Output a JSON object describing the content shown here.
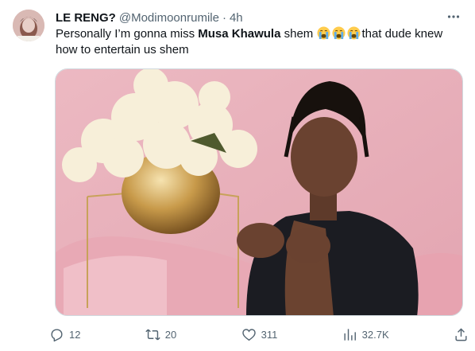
{
  "tweet": {
    "display_name": "LE RENG?",
    "handle": "@Modimoonrumile",
    "separator": "·",
    "time": "4h",
    "text_part1": "Personally I’m gonna miss ",
    "text_bold": "Musa Khawula",
    "text_part2": " shem ",
    "text_part3": "that dude knew how to entertain us shem",
    "emoji": "loudly-crying-face"
  },
  "actions": {
    "replies": "12",
    "reposts": "20",
    "likes": "311",
    "views": "32.7K"
  },
  "icons": {
    "reply": "reply-icon",
    "repost": "repost-icon",
    "like": "heart-icon",
    "views": "views-icon",
    "share": "share-icon",
    "more": "more-icon"
  },
  "colors": {
    "text": "#0f1419",
    "secondary": "#536471",
    "border": "#cfd9de",
    "photo_background": "#e8aeb8"
  }
}
